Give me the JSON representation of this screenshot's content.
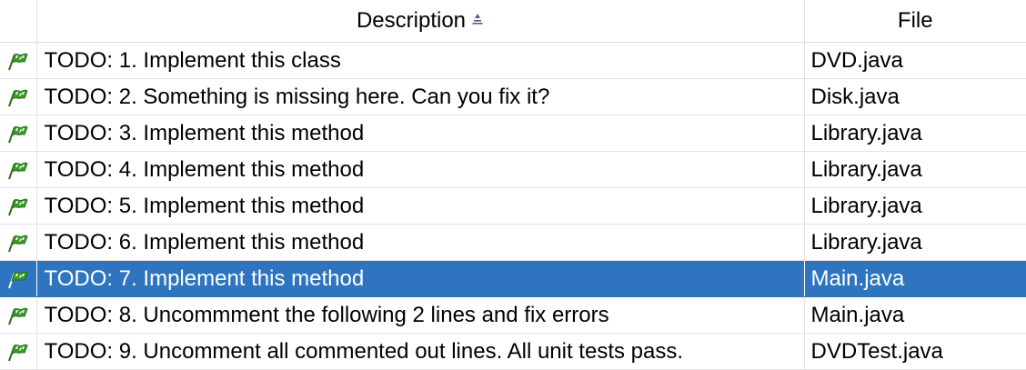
{
  "columns": {
    "description": "Description",
    "file": "File"
  },
  "colors": {
    "selection": "#2e74bf",
    "flag_green": "#3b9a28"
  },
  "icon": "todo-flag-icon",
  "tasks": [
    {
      "description": "TODO: 1. Implement this class",
      "file": "DVD.java",
      "selected": false
    },
    {
      "description": "TODO: 2. Something is missing here. Can you fix it?",
      "file": "Disk.java",
      "selected": false
    },
    {
      "description": "TODO: 3. Implement this method",
      "file": "Library.java",
      "selected": false
    },
    {
      "description": "TODO: 4. Implement this method",
      "file": "Library.java",
      "selected": false
    },
    {
      "description": "TODO: 5. Implement this method",
      "file": "Library.java",
      "selected": false
    },
    {
      "description": "TODO: 6. Implement this method",
      "file": "Library.java",
      "selected": false
    },
    {
      "description": "TODO: 7. Implement this method",
      "file": "Main.java",
      "selected": true
    },
    {
      "description": "TODO: 8. Uncommment the following 2 lines and fix errors",
      "file": "Main.java",
      "selected": false
    },
    {
      "description": "TODO: 9. Uncomment all commented out lines.  All unit tests pass.",
      "file": "DVDTest.java",
      "selected": false
    }
  ]
}
